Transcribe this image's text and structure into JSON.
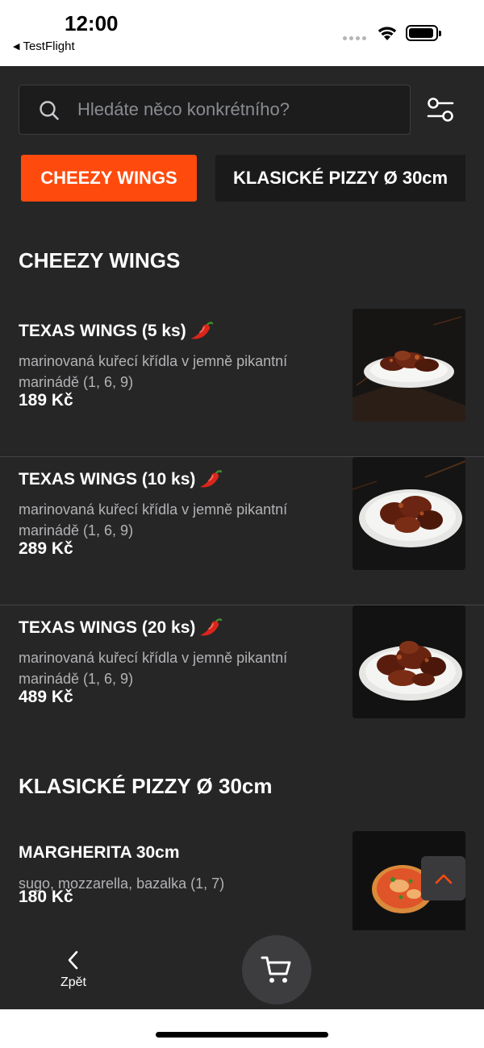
{
  "status_bar": {
    "time": "12:00",
    "back_app": "TestFlight"
  },
  "search": {
    "placeholder": "Hledáte něco konkrétního?"
  },
  "tabs": [
    {
      "label": "CHEEZY WINGS",
      "active": true
    },
    {
      "label": "KLASICKÉ PIZZY Ø 30cm",
      "active": false
    }
  ],
  "sections": [
    {
      "title": "CHEEZY WINGS",
      "items": [
        {
          "name": "TEXAS WINGS (5 ks)",
          "spicy": true,
          "description": "marinovaná kuřecí křídla v jemně pikantní marinádě (1, 6, 9)",
          "price": "189 Kč"
        },
        {
          "name": "TEXAS WINGS (10 ks)",
          "spicy": true,
          "description": "marinovaná kuřecí křídla v jemně pikantní marinádě (1, 6, 9)",
          "price": "289 Kč"
        },
        {
          "name": "TEXAS WINGS (20 ks)",
          "spicy": true,
          "description": "marinovaná kuřecí křídla v jemně pikantní marinádě (1, 6, 9)",
          "price": "489 Kč"
        }
      ]
    },
    {
      "title": "KLASICKÉ PIZZY Ø 30cm",
      "items": [
        {
          "name": "MARGHERITA 30cm",
          "spicy": false,
          "description": "sugo, mozzarella, bazalka (1, 7)",
          "price": "180 Kč"
        }
      ]
    }
  ],
  "bottom_nav": {
    "back_label": "Zpět"
  },
  "colors": {
    "accent": "#ff4a0d",
    "background": "#262627",
    "text": "#ffffff",
    "muted_text": "#b3b3b6"
  },
  "icons": [
    "search-icon",
    "filter-icon",
    "chili-pepper-icon",
    "chevron-up-icon",
    "chevron-left-icon",
    "cart-icon",
    "wifi-icon",
    "battery-icon"
  ]
}
